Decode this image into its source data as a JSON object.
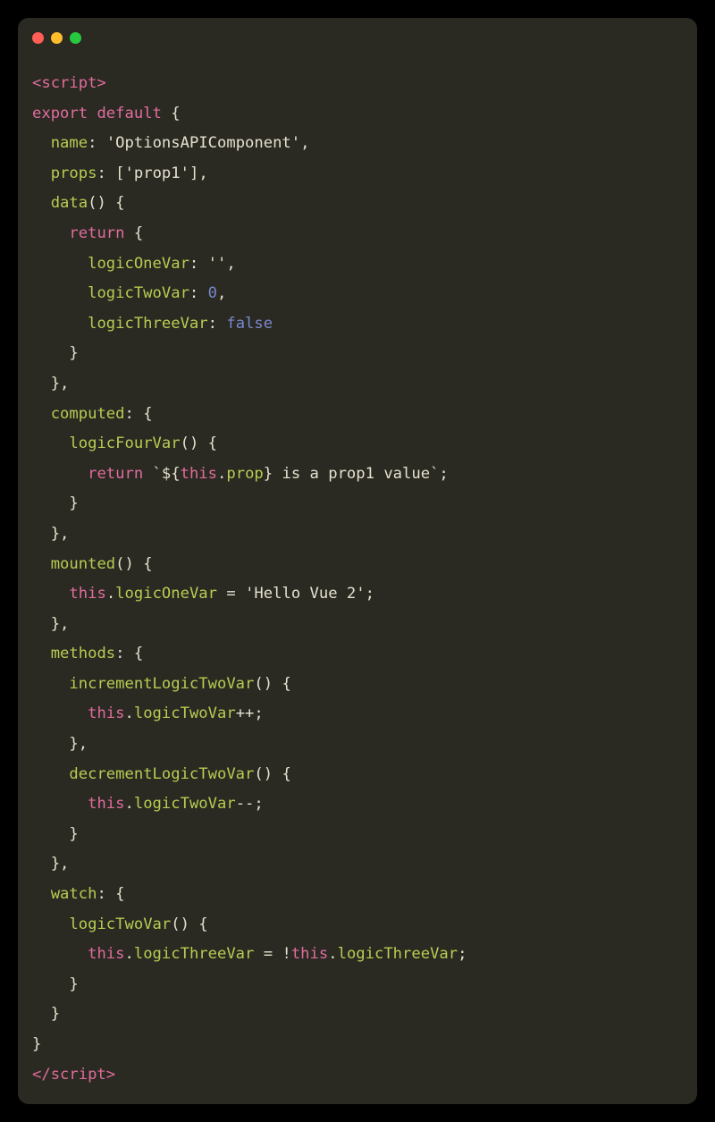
{
  "titlebar": {
    "close": "close",
    "minimize": "minimize",
    "maximize": "maximize"
  },
  "code": {
    "tag_open": "<script>",
    "tag_close": "</script>",
    "kw_export": "export",
    "kw_default": "default",
    "kw_return": "return",
    "kw_this": "this",
    "prop_name": "name",
    "val_name": "'OptionsAPIComponent'",
    "prop_props": "props",
    "val_props": "'prop1'",
    "prop_data": "data",
    "d_logicOneVar": "logicOneVar",
    "d_logicOneVal": "''",
    "d_logicTwoVar": "logicTwoVar",
    "d_logicTwoVal": "0",
    "d_logicThreeVar": "logicThreeVar",
    "d_logicThreeVal": "false",
    "prop_computed": "computed",
    "c_logicFourVar": "logicFourVar",
    "c_prop": "prop",
    "c_template_text": " is a prop1 value",
    "prop_mounted": "mounted",
    "m_logicOneVar": "logicOneVar",
    "m_string": "'Hello Vue 2'",
    "prop_methods": "methods",
    "me_incr": "incrementLogicTwoVar",
    "me_decr": "decrementLogicTwoVar",
    "me_logicTwoVar": "logicTwoVar",
    "prop_watch": "watch",
    "w_logicTwoVar": "logicTwoVar",
    "w_logicThreeVar": "logicThreeVar"
  }
}
